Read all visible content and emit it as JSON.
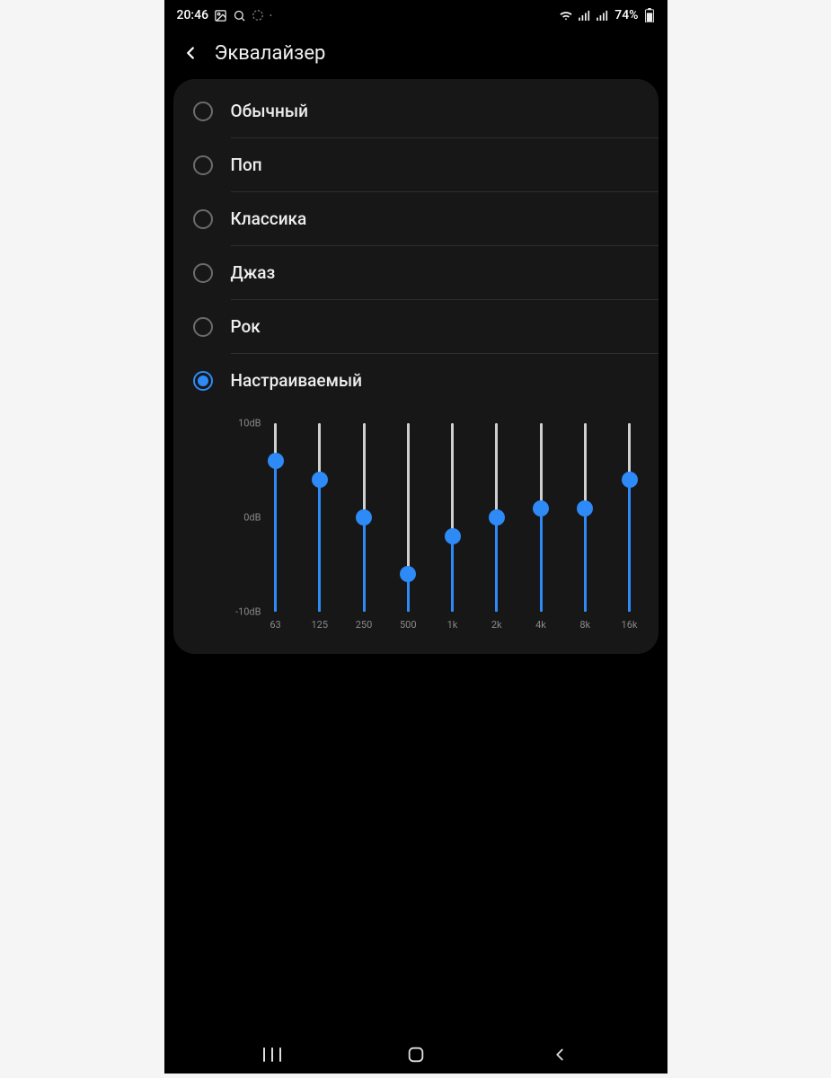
{
  "status_bar": {
    "time": "20:46",
    "battery": "74%"
  },
  "header": {
    "title": "Эквалайзер"
  },
  "presets": [
    {
      "label": "Обычный",
      "selected": false
    },
    {
      "label": "Поп",
      "selected": false
    },
    {
      "label": "Классика",
      "selected": false
    },
    {
      "label": "Джаз",
      "selected": false
    },
    {
      "label": "Рок",
      "selected": false
    },
    {
      "label": "Настраиваемый",
      "selected": true
    }
  ],
  "chart_data": {
    "type": "bar",
    "categories": [
      "63",
      "125",
      "250",
      "500",
      "1k",
      "2k",
      "4k",
      "8k",
      "16k"
    ],
    "values": [
      6,
      4,
      0,
      -6,
      -2,
      0,
      1,
      1,
      4
    ],
    "ylim": [
      -10,
      10
    ],
    "yticks": [
      "10dB",
      "0dB",
      "-10dB"
    ],
    "ylabel": "dB",
    "accent": "#2d8af7"
  }
}
